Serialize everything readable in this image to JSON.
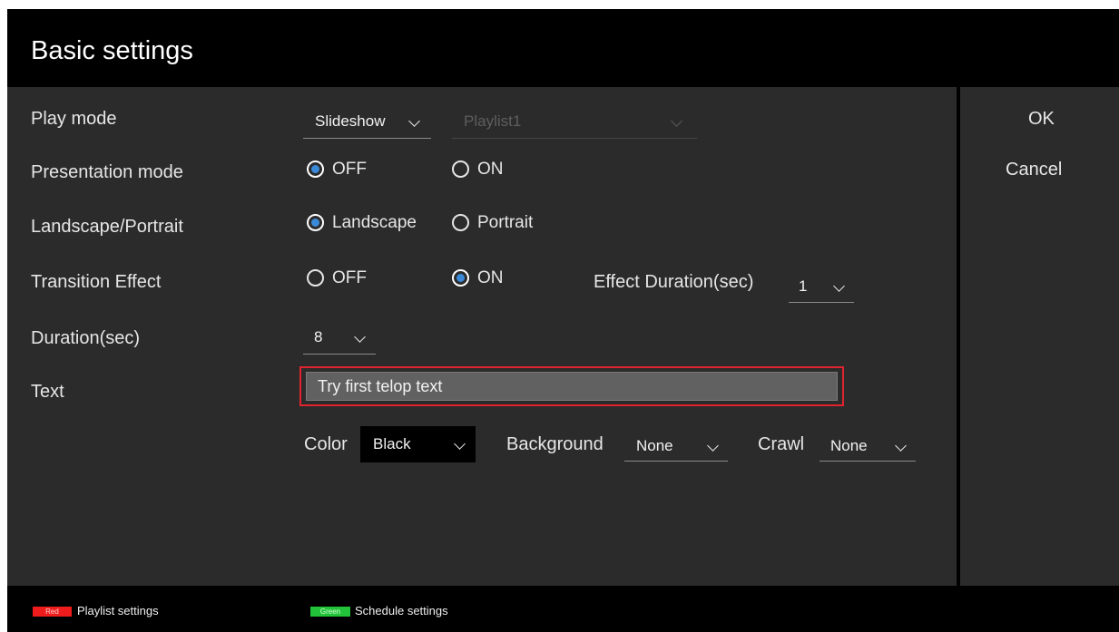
{
  "header": {
    "title": "Basic settings"
  },
  "side": {
    "ok": "OK",
    "cancel": "Cancel"
  },
  "rows": {
    "play_mode": {
      "label": "Play mode",
      "mode_value": "Slideshow",
      "playlist_value": "Playlist1"
    },
    "presentation_mode": {
      "label": "Presentation mode",
      "off": "OFF",
      "on": "ON",
      "selected": "OFF"
    },
    "orientation": {
      "label": "Landscape/Portrait",
      "landscape": "Landscape",
      "portrait": "Portrait",
      "selected": "Landscape"
    },
    "transition": {
      "label": "Transition Effect",
      "off": "OFF",
      "on": "ON",
      "selected": "ON",
      "effect_label": "Effect Duration(sec)",
      "effect_value": "1"
    },
    "duration": {
      "label": "Duration(sec)",
      "value": "8"
    },
    "text": {
      "label": "Text",
      "value": "Try first telop text"
    },
    "style": {
      "color_label": "Color",
      "color_value": "Black",
      "background_label": "Background",
      "background_value": "None",
      "crawl_label": "Crawl",
      "crawl_value": "None"
    }
  },
  "footer": {
    "red": {
      "badge": "Red",
      "label": "Playlist settings",
      "color": "#ee1c1c"
    },
    "green": {
      "badge": "Green",
      "label": "Schedule settings",
      "color": "#22c33a"
    }
  },
  "colors": {
    "header_bg": "#000000",
    "panel_bg": "#2b2b2b",
    "accent": "#3b8ad9",
    "highlight_border": "#e0242f"
  }
}
